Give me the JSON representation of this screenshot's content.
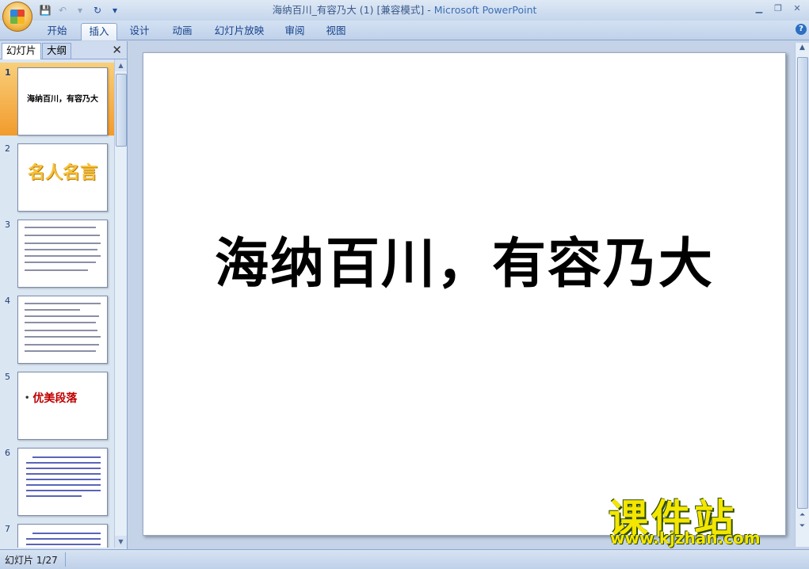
{
  "window": {
    "title_doc": "海纳百川_有容乃大 (1) [兼容模式]",
    "title_sep": " - ",
    "title_app": "Microsoft PowerPoint"
  },
  "ribbon": {
    "tabs": [
      "开始",
      "插入",
      "设计",
      "动画",
      "幻灯片放映",
      "审阅",
      "视图"
    ],
    "active_tab": "插入"
  },
  "pane": {
    "tabs": [
      "幻灯片",
      "大纲"
    ],
    "close": "✕"
  },
  "thumbnails": [
    {
      "num": "1",
      "title": "海纳百川，有容乃大"
    },
    {
      "num": "2",
      "title": "名人名言"
    },
    {
      "num": "3"
    },
    {
      "num": "4"
    },
    {
      "num": "5",
      "title": "优美段落"
    },
    {
      "num": "6"
    },
    {
      "num": "7"
    }
  ],
  "slide": {
    "title": "海纳百川，有容乃大"
  },
  "watermark": {
    "main": "课件站",
    "url": "www.kjzhan.com"
  },
  "status": {
    "slide_info": "幻灯片 1/27"
  },
  "colors": {
    "selected_thumb": "#f29b2c",
    "thumb2_title": "#f7c23a",
    "thumb5_title": "#c00000",
    "watermark": "#f4e600"
  }
}
